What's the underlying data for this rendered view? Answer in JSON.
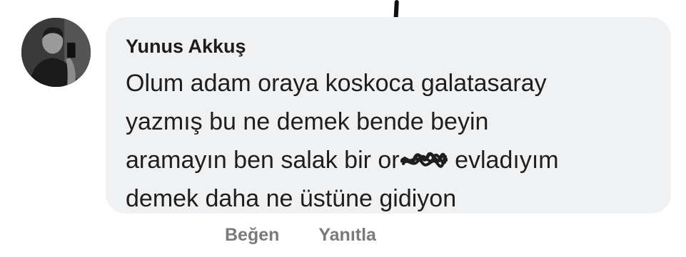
{
  "comment": {
    "author": "Yunus Akkuş",
    "message_lines": [
      "Olum adam oraya koskoca galatasaray",
      "yazmış bu ne demek bende beyin",
      "aramayın ben salak bir or",
      "evladıyım",
      "demek daha ne üstüne gidiyon"
    ],
    "avatar_icon": "profile-photo-icon",
    "censor_icon": "scribble-redaction-icon"
  },
  "actions": {
    "like_label": "Beğen",
    "reply_label": "Yanıtla"
  },
  "colors": {
    "bubble_bg": "#f0f1f3",
    "text": "#1e1e1e",
    "action_text": "#7a7a7a"
  }
}
